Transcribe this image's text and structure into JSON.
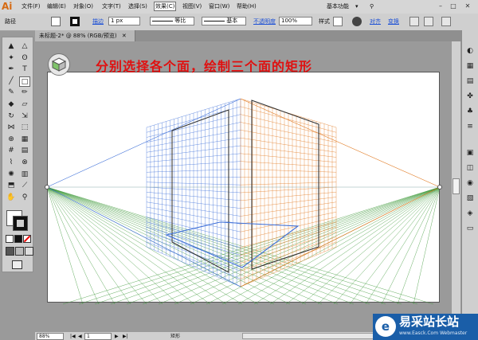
{
  "app": {
    "logo": "Ai",
    "workspace": "基本功能"
  },
  "menu": [
    {
      "label": "文件(F)",
      "key": "file"
    },
    {
      "label": "编辑(E)",
      "key": "edit"
    },
    {
      "label": "对象(O)",
      "key": "object"
    },
    {
      "label": "文字(T)",
      "key": "type"
    },
    {
      "label": "选择(S)",
      "key": "select"
    },
    {
      "label": "效果(C)",
      "key": "effect",
      "active": true
    },
    {
      "label": "视图(V)",
      "key": "view"
    },
    {
      "label": "窗口(W)",
      "key": "window"
    },
    {
      "label": "帮助(H)",
      "key": "help"
    }
  ],
  "window_buttons": [
    "–",
    "□",
    "✕"
  ],
  "control": {
    "selection_label": "路径",
    "stroke_label": "描边",
    "stroke_value": "1 px",
    "profile_label": "等比",
    "brush_label": "基本",
    "opacity_label": "不透明度",
    "opacity_value": "100%",
    "style_label": "样式",
    "align_label": "对齐",
    "transform_label": "变换"
  },
  "document": {
    "tab": "未标题-2* @ 88% (RGB/预览)"
  },
  "canvas": {
    "instruction": "分别选择各个面，绘制三个面的矩形"
  },
  "tools": [
    {
      "name": "selection-tool",
      "glyph": "▲",
      "selected": false
    },
    {
      "name": "direct-selection-tool",
      "glyph": "△",
      "selected": false
    },
    {
      "name": "magic-wand-tool",
      "glyph": "✦",
      "selected": false
    },
    {
      "name": "lasso-tool",
      "glyph": "ʘ",
      "selected": false
    },
    {
      "name": "pen-tool",
      "glyph": "✒",
      "selected": false
    },
    {
      "name": "type-tool",
      "glyph": "T",
      "selected": false
    },
    {
      "name": "line-segment-tool",
      "glyph": "╱",
      "selected": false
    },
    {
      "name": "rectangle-tool",
      "glyph": "□",
      "selected": true
    },
    {
      "name": "paintbrush-tool",
      "glyph": "✎",
      "selected": false
    },
    {
      "name": "pencil-tool",
      "glyph": "✏",
      "selected": false
    },
    {
      "name": "blob-brush-tool",
      "glyph": "◆",
      "selected": false
    },
    {
      "name": "eraser-tool",
      "glyph": "▱",
      "selected": false
    },
    {
      "name": "rotate-tool",
      "glyph": "↻",
      "selected": false
    },
    {
      "name": "scale-tool",
      "glyph": "⇲",
      "selected": false
    },
    {
      "name": "width-tool",
      "glyph": "⋈",
      "selected": false
    },
    {
      "name": "free-transform-tool",
      "glyph": "⬚",
      "selected": false
    },
    {
      "name": "shape-builder-tool",
      "glyph": "⊕",
      "selected": false
    },
    {
      "name": "perspective-grid-tool",
      "glyph": "▦",
      "selected": false
    },
    {
      "name": "mesh-tool",
      "glyph": "#",
      "selected": false
    },
    {
      "name": "gradient-tool",
      "glyph": "▤",
      "selected": false
    },
    {
      "name": "eyedropper-tool",
      "glyph": "⌇",
      "selected": false
    },
    {
      "name": "blend-tool",
      "glyph": "⊗",
      "selected": false
    },
    {
      "name": "symbol-sprayer-tool",
      "glyph": "✺",
      "selected": false
    },
    {
      "name": "column-graph-tool",
      "glyph": "▥",
      "selected": false
    },
    {
      "name": "artboard-tool",
      "glyph": "⬒",
      "selected": false
    },
    {
      "name": "slice-tool",
      "glyph": "⟋",
      "selected": false
    },
    {
      "name": "hand-tool",
      "glyph": "✋",
      "selected": false
    },
    {
      "name": "zoom-tool",
      "glyph": "⚲",
      "selected": false
    }
  ],
  "right_panel_icons": [
    "color-icon",
    "color-guide-icon",
    "swatches-icon",
    "brushes-icon",
    "symbols-icon",
    "stroke-icon",
    "gradient-icon",
    "transparency-icon",
    "appearance-icon",
    "graphic-styles-icon",
    "layers-icon",
    "artboards-icon"
  ],
  "right_panel_glyphs": [
    "◐",
    "▦",
    "▤",
    "✤",
    "♣",
    "≡",
    "▣",
    "◫",
    "◉",
    "▧",
    "◈",
    "▭"
  ],
  "status": {
    "zoom": "88%",
    "page": "1",
    "tool": "矩形"
  },
  "watermark": {
    "logo": "e",
    "title": "易采站长站",
    "url": "www.Easck.Com Webmaster"
  },
  "colors": {
    "left_plane": "#3d6fd8",
    "right_plane": "#e0771d",
    "ground_plane": "#3f9a3a",
    "instruction": "#e01010"
  }
}
